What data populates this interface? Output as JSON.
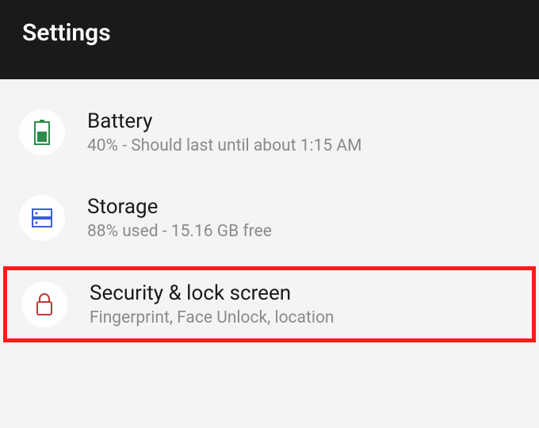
{
  "header": {
    "title": "Settings"
  },
  "items": [
    {
      "title": "Battery",
      "subtitle": "40% - Should last until about 1:15 AM",
      "icon": "battery-icon"
    },
    {
      "title": "Storage",
      "subtitle": "88% used - 15.16 GB free",
      "icon": "storage-icon"
    },
    {
      "title": "Security & lock screen",
      "subtitle": "Fingerprint, Face Unlock, location",
      "icon": "lock-icon",
      "highlighted": true
    }
  ],
  "colors": {
    "battery_icon": "#2e8b4a",
    "storage_icon": "#3b5fd6",
    "lock_icon": "#b83a3a",
    "highlight_border": "#ff1a1a"
  }
}
